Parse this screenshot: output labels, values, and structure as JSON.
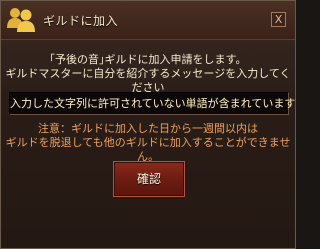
{
  "window": {
    "title": "ギルドに加入",
    "close_label": "X",
    "icon": "guild-members-icon"
  },
  "message": {
    "line1": "｢予後の音｣ギルドに加入申請をします。",
    "line2": "ギルドマスターに自分を紹介するメッセージを入力してください"
  },
  "input_notice": "入力した文字列に許可されていない単語が含まれています",
  "caution": {
    "line1": "注意：ギルドに加入した日から一週間以内は",
    "line2": "ギルドを脱退しても他のギルドに加入することができません。"
  },
  "confirm_label": "確認",
  "colors": {
    "background": "#2a1d18",
    "title_text": "#f3e7c8",
    "body_text": "#f5ebd0",
    "caution_text": "#f0a05a",
    "button": "#6e1d12"
  }
}
